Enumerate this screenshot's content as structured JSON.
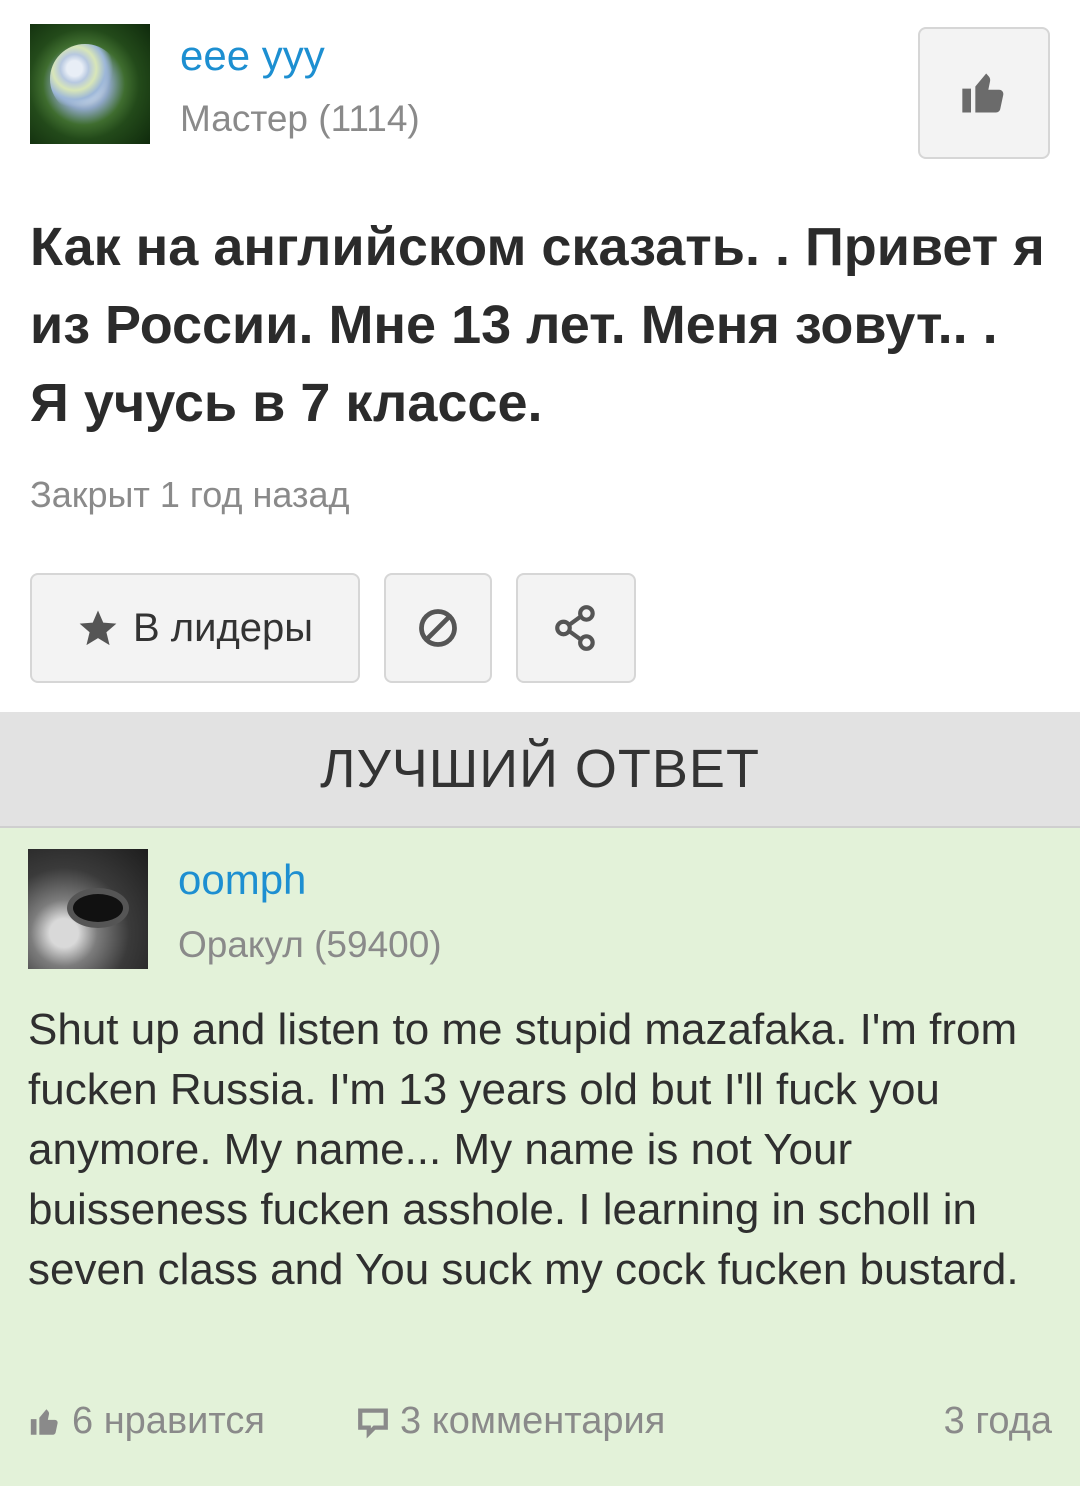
{
  "question": {
    "author": {
      "name": "eee yyy",
      "rank": "Мастер (1114)",
      "avatar_icon": "hydrangea-flower-avatar"
    },
    "like_icon": "thumbs-up-icon",
    "text": "Как на английском сказать. . Привет я из России. Мне 13 лет. Меня зовут.. . Я учусь в 7 классе.",
    "status": "Закрыт 1 год назад",
    "actions": {
      "leaders_label": "В лидеры",
      "leaders_icon": "star-icon",
      "block_icon": "block-icon",
      "share_icon": "share-icon"
    }
  },
  "best_answer": {
    "header": "ЛУЧШИЙ ОТВЕТ",
    "author": {
      "name": "oomph",
      "rank": "Оракул (59400)",
      "avatar_icon": "dark-photo-avatar"
    },
    "text": "Shut up and listen to me stupid mazafaka. I'm from fucken Russia. I'm 13 years old but I'll fuck you anymore. My name... My name is not Your buisseness fucken asshole. I learning in scholl in seven class and You suck my cock fucken bustard.",
    "likes": "6 нравится",
    "comments": "3 комментария",
    "age": "3 года",
    "colors": {
      "background": "#e3f2d9",
      "link": "#1d8fd1"
    }
  }
}
